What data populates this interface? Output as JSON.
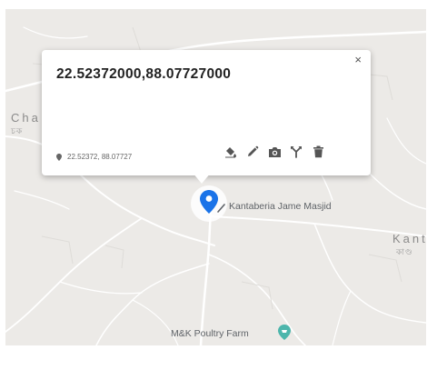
{
  "map": {
    "places": [
      {
        "name": "Cha",
        "sublabel": "চক"
      },
      {
        "name": "Kant",
        "sublabel": "কাণ্ড"
      }
    ],
    "pois": [
      {
        "label": "Kantaberia Jame Masjid"
      },
      {
        "label": "M&K Poultry Farm"
      }
    ]
  },
  "popup": {
    "title": "22.52372000,88.07727000",
    "coordinates": "22.52372, 88.07727",
    "close_symbol": "×",
    "tools": [
      "fill-icon",
      "pencil-icon",
      "camera-icon",
      "route-icon",
      "trash-icon"
    ]
  },
  "colors": {
    "marker": "#1a73e8",
    "map_background": "#eceae7",
    "road": "#ffffff",
    "poi_green": "#4db6ac"
  }
}
